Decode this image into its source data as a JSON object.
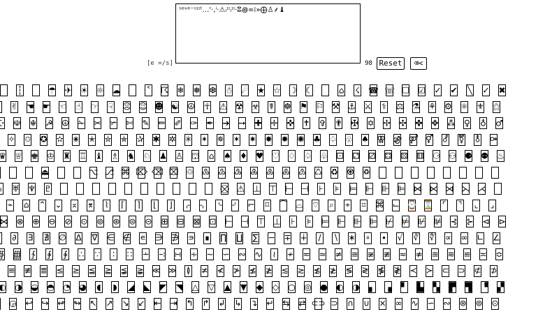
{
  "editor": {
    "value": "ˢᵉᵛᵉ⁻ˢᶦᶦᵗ…'·,ⁱ·⚠ᵢᶦᶦᵢᶦᶦ⸱ⵓ꩜∞⁞»⨁♙⸙♝"
  },
  "controls": {
    "hint": "[e =/s]",
    "count": "98",
    "reset_label": "Reset",
    "backspace_label": "⌫<"
  },
  "glyph_rows": [
    [
      "",
      "┆",
      "",
      "☂",
      "✈",
      "☀",
      "☼",
      "☁",
      "",
      "˂",
      "☈",
      "❄",
      "❅",
      "❆",
      "☃",
      "☄",
      "★",
      "☆",
      "☽",
      "☾",
      "",
      "⌂",
      "☇",
      "☎",
      "☏",
      "☐",
      "☑",
      "✓",
      "✔",
      "╲",
      "✓",
      "✖"
    ],
    [
      "",
      "✌",
      "☚",
      "☛",
      "☜",
      "☝",
      "☞",
      "☟",
      "☹",
      "☺",
      "☻",
      "☯",
      "☮",
      "☥",
      "⚠",
      "☢",
      "☣",
      "☤",
      "☸",
      "⚑",
      "⚐",
      "⚒",
      "⚓",
      "⚔",
      "⚕",
      "⚖",
      "⚗",
      "⚘",
      "⚙",
      "⚛",
      "⚜",
      "⚝"
    ],
    [
      "☪",
      "☫",
      "☬",
      "☭",
      "☮",
      "✁",
      "✂",
      "✃",
      "✄",
      "✎",
      "✏",
      "✐",
      "✑",
      "✒",
      "➔",
      "➙",
      "✚",
      "✛",
      "✜",
      "✝",
      "✞",
      "✟",
      "✠",
      "✡",
      "✢",
      "✣",
      "✤",
      "✥",
      "⁂",
      "♀",
      "♁",
      "♂"
    ],
    [
      "✦",
      "✧",
      "✩",
      "✪",
      "✫",
      "✬",
      "✭",
      "✮",
      "✯",
      "✰",
      "✱",
      "✲",
      "✳",
      "✴",
      "✵",
      "✶",
      "✷",
      "✸",
      "✹",
      "✺",
      "♣",
      "♤",
      "♧",
      "♠",
      "⚢",
      "⚣",
      "⚤",
      "⚥",
      "⚦",
      "⚧",
      "⚨",
      "⚩"
    ],
    [
      "♛",
      "♕",
      "♚",
      "♔",
      "♜",
      "♖",
      "♝",
      "♗",
      "♞",
      "♘",
      "♟",
      "♙",
      "⛫",
      "⌂",
      "♠",
      "♦",
      "♥",
      "♡",
      "♢",
      "♤",
      "♧",
      "⚀",
      "⚁",
      "⚂",
      "⚃",
      "⚄",
      "⚅",
      "⚆",
      "⚇",
      "⚈",
      "⚉",
      "♨"
    ],
    [
      "",
      "",
      "",
      "⏏",
      "",
      "",
      "⌥",
      "⎇",
      "⌘",
      "⌦",
      "⌫",
      "⌧",
      "♲",
      "♳",
      "♴",
      "♵",
      "♶",
      "♷",
      "♸",
      "♹",
      "♺",
      "♻",
      "♼",
      "♽",
      "",
      "",
      "",
      "",
      "",
      "",
      "",
      ""
    ],
    [
      "♄",
      "♅",
      "♆",
      "♇",
      "",
      "",
      "",
      "",
      "",
      "",
      "",
      "",
      "",
      "",
      "⛒",
      "⚠",
      "⊥",
      "⊤",
      "⊢",
      "⊣",
      "⊦",
      "⊧",
      "⊨",
      "⊩",
      "⊪",
      "⊫",
      "⋈",
      "⋉",
      "⋊",
      "⋋",
      "⋌",
      ""
    ],
    [
      "⍟",
      "⌁",
      "⌂",
      "⌃",
      "⌄",
      "⌅",
      "⌆",
      "⌇",
      "⌈",
      "⌉",
      "⌊",
      "⌋",
      "⌌",
      "⌍",
      "⌎",
      "⌏",
      "⌐",
      "⌑",
      "⌒",
      "⌓",
      "⌔",
      "⌕",
      "⌖",
      "⌗",
      "⌘",
      "⌙",
      "⌚",
      "⌛",
      "⌜",
      "⌝",
      "⌞",
      "⌟"
    ],
    [
      "⋈",
      "⊗",
      "⊕",
      "⊖",
      "⊘",
      "⊙",
      "⊚",
      "⊛",
      "⊜",
      "⊝",
      "⊞",
      "⊟",
      "⊠",
      "⊡",
      "⊢",
      "⊣",
      "⊤",
      "⊥",
      "⊦",
      "⊧",
      "⊨",
      "⊩",
      "⊪",
      "⊫",
      "⊬",
      "⊭",
      "⊮",
      "⊯",
      "⊰",
      "⊱",
      "⊲",
      "⊳"
    ],
    [
      "∁",
      "∂",
      "∃",
      "∄",
      "∅",
      "∆",
      "∇",
      "∈",
      "∉",
      "∊",
      "∋",
      "∌",
      "∍",
      "∎",
      "∏",
      "∐",
      "∑",
      "−",
      "∓",
      "∔",
      "∕",
      "∖",
      "∗",
      "∘",
      "∙",
      "√",
      "∛",
      "∜",
      "∝",
      "∞",
      "∟",
      "∠"
    ],
    [
      "∯",
      "∰",
      "∱",
      "∲",
      "∳",
      "∴",
      "∵",
      "∶",
      "∷",
      "∸",
      "∹",
      "∺",
      "∻",
      "∼",
      "∽",
      "∾",
      "∿",
      "≀",
      "≁",
      "≂",
      "≃",
      "≄",
      "≅",
      "≆",
      "≇",
      "≈",
      "≉",
      "≊",
      "≋",
      "≌",
      "≍",
      "≎"
    ],
    [
      "≠",
      "≡",
      "≢",
      "≣",
      "≤",
      "≥",
      "≦",
      "≧",
      "≨",
      "≩",
      "≪",
      "≫",
      "≬",
      "≭",
      "≮",
      "≯",
      "≰",
      "≱",
      "≲",
      "≳",
      "≴",
      "≵",
      "≶",
      "≷",
      "≸",
      "≹",
      "≺",
      "≻",
      "⊂",
      "⊃",
      "⊄",
      "⊅"
    ],
    [
      "◐",
      "◑",
      "◒",
      "◓",
      "◔",
      "◕",
      "◖",
      "◗",
      "◢",
      "◣",
      "◤",
      "◥",
      "△",
      "▽",
      "▲",
      "▼",
      "◆",
      "◇",
      "○",
      "◎",
      "●",
      "◐",
      "◑",
      "▖",
      "▗",
      "▘",
      "▙",
      "▚",
      "▛",
      "▜",
      "▝",
      "▞"
    ],
    [
      "◷",
      "◶",
      "↩",
      "↪",
      "↫",
      "↬",
      "↖",
      "↗",
      "↘",
      "↙",
      "⇤",
      "⇥",
      "↰",
      "↱",
      "↲",
      "↳",
      "↴",
      "↵",
      "⇆",
      "⇄",
      "⊂⊃",
      "⊃",
      "∩",
      "∪",
      "×",
      "∞",
      "∿",
      "∽",
      "∾",
      "⊛",
      "⊚",
      "⊙"
    ]
  ]
}
